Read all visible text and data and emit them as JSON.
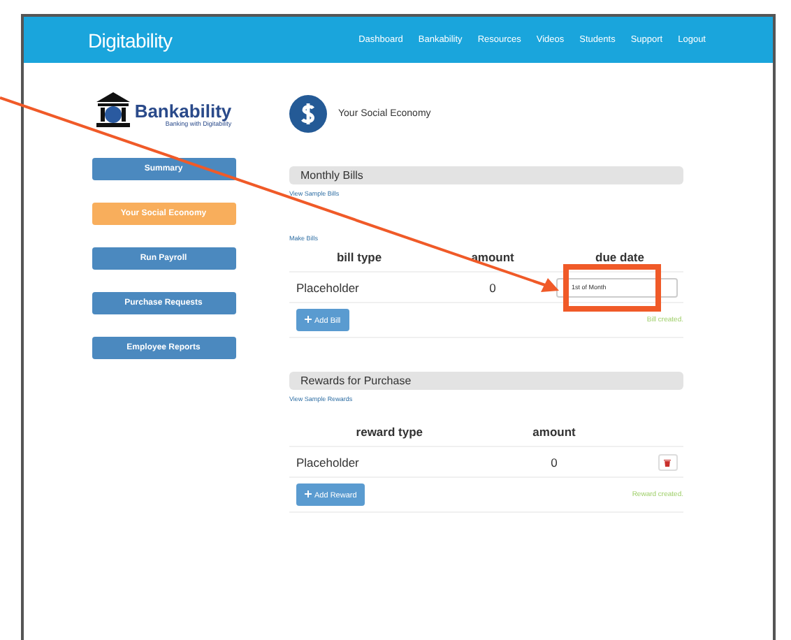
{
  "header": {
    "logo": "Digitability",
    "nav": [
      "Dashboard",
      "Bankability",
      "Resources",
      "Videos",
      "Students",
      "Support",
      "Logout"
    ]
  },
  "sidebar": {
    "logo": "Bankability",
    "tagline": "Banking with Digitability",
    "items": [
      {
        "label": "Summary",
        "selected": false
      },
      {
        "label": "Your Social Economy",
        "selected": true
      },
      {
        "label": "Run Payroll",
        "selected": false
      },
      {
        "label": "Purchase Requests",
        "selected": false
      },
      {
        "label": "Employee Reports",
        "selected": false
      }
    ]
  },
  "page_title": "Your Social Economy",
  "bills": {
    "title": "Monthly Bills",
    "link": "View Sample Bills",
    "sub_link": "Make Bills",
    "columns": [
      "bill type",
      "amount",
      "due date"
    ],
    "rows": [
      {
        "type": "Placeholder",
        "amount": "0",
        "due": "1st of Month"
      }
    ],
    "add_button": "Add Bill",
    "status": "Bill created."
  },
  "rewards": {
    "title": "Rewards for Purchase",
    "link": "View Sample Rewards",
    "columns": [
      "reward type",
      "amount"
    ],
    "rows": [
      {
        "type": "Placeholder",
        "amount": "0"
      }
    ],
    "add_button": "Add Reward",
    "status": "Reward created."
  }
}
